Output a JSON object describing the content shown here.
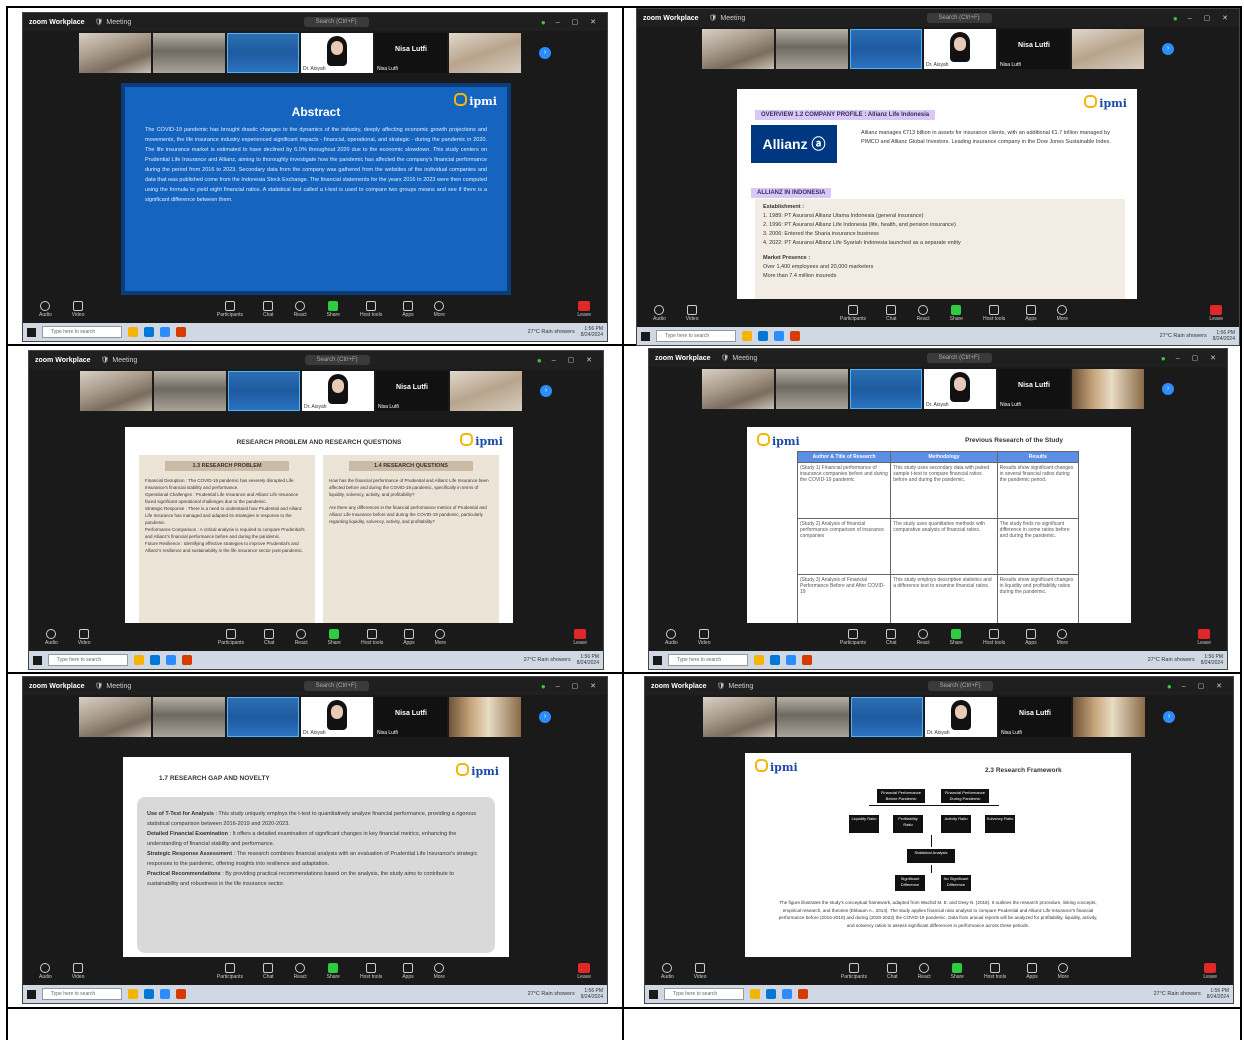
{
  "zoom": {
    "brand": "zoom\nWorkplace",
    "meeting_label": "Meeting",
    "search_placeholder": "Search (Ctrl+F)",
    "win_controls": "– ▢ ✕",
    "more_participants_arrow": "›"
  },
  "participants": {
    "dr_label": "Dr. Aisyah",
    "nisa_name": "Nisa Lutfi",
    "nisa_sub": "Nisa Lutfi"
  },
  "controls": {
    "audio": "Audio",
    "video": "Video",
    "participants": "Participants",
    "chat": "Chat",
    "react": "React",
    "share": "Share",
    "host_tools": "Host tools",
    "apps": "Apps",
    "more": "More",
    "leave": "Leave"
  },
  "taskbar": {
    "search_placeholder": "Type here to search",
    "weather": "27°C Rain showers",
    "clock_time": "1:56 PM",
    "clock_date": "8/24/2024"
  },
  "slides": {
    "logo_text": "ipmi",
    "abstract": {
      "title": "Abstract",
      "text": "The COVID-19 pandemic has brought drastic changes to the dynamics of the industry, deeply affecting economic growth projections and movements, the life insurance industry experienced significant impacts - financial, operational, and strategic - during the pandemic in 2020. The life insurance market is estimated to have declined by 6.0% throughout 2020 due to the economic slowdown. This study centers on Prudential Life Insurance and Allianz, aiming to thoroughly investigate how the pandemic has affected the company's financial performance during the period from 2016 to 2023. Secondary data from the company was gathered from the websites of the individual companies and data that was published come from the Indonesia Stock Exchange. The financial statements for the years 2016 to 2023 were then computed using the formula to yield eight financial ratios. A statistical test called a t-test is used to compare two groups means and see if there is a significant difference between them."
    },
    "allianz": {
      "section": "OVERVIEW  1.2 COMPANY PROFILE : Allianz Life Indonesia",
      "logo": "Allianz ⓐ",
      "desc": "Allianz manages €713 billion in assets for insurance clients, with an additional €1.7 trillion managed by PIMCO and Allianz Global Investors. Leading insurance company in the Dow Jones Sustainable Index.",
      "sub": "ALLIANZ IN INDONESIA",
      "est_title": "Establishment :",
      "est_items": [
        "1. 1989: PT Asuransi Allianz Utama Indonesia (general insurance)",
        "2. 1996: PT Asuransi Allianz Life Indonesia (life, health, and pension insurance)",
        "3. 2006: Entered the Sharia insurance business",
        "4. 2022: PT Asuransi Allianz Life Syariah Indonesia launched as a separate entity"
      ],
      "market_title": "Market Presence :",
      "market_items": [
        "Over 1,400 employees and 20,000 marketers",
        "More than 7.4 million insureds"
      ]
    },
    "research": {
      "title": "RESEARCH PROBLEM AND RESEARCH QUESTIONS",
      "left_header": "1.3 RESEARCH PROBLEM",
      "left_items": [
        "Financial Disruption : The COVID-19 pandemic has severely disrupted Life Insurance's financial stability and performance.",
        "Operational Challenges : Prudential Life Insurance and Allianz Life Insurance faced significant operational challenges due to the pandemic.",
        "Strategic Response : There is a need to understand how Prudential and Allianz Life Insurance has managed and adapted its strategies in response to the pandemic.",
        "Performance Comparison : A critical analysis is required to compare Prudential's and Allianz's financial performance before and during the pandemic.",
        "Future Resilience : Identifying effective strategies to improve Prudential's and Allianz's resilience and sustainability in the life insurance sector post-pandemic."
      ],
      "right_header": "1.4 RESEARCH QUESTIONS",
      "right_items": [
        "How has the financial performance of Prudential and Allianz Life Insurance been affected before and during the COVID-19 pandemic, specifically in terms of liquidity, solvency, activity, and profitability?",
        "Are there any differences in the financial performance metrics of Prudential and Allianz Life Insurance before and during the COVID-19 pandemic, particularly regarding liquidity, solvency, activity, and profitability?"
      ]
    },
    "previous": {
      "title": "Previous Research of the Study",
      "headers": [
        "Author & Title of Research",
        "Methodology",
        "Results"
      ],
      "rows": [
        [
          "(Study 1) Financial performance of insurance companies before and during the COVID-19 pandemic",
          "This study uses secondary data with paired sample t-test to compare financial ratios before and during the pandemic.",
          "Results show significant changes in several financial ratios during the pandemic period."
        ],
        [
          "(Study 2) Analysis of financial performance comparison of insurance companies",
          "The study uses quantitative methods with comparative analysis of financial ratios.",
          "The study finds no significant difference in some ratios before and during the pandemic."
        ],
        [
          "(Study 3) Analysis of Financial Performance Before and After COVID-19",
          "This study employs descriptive statistics and a difference test to examine financial ratios.",
          "Results show significant changes in liquidity and profitability ratios during the pandemic."
        ]
      ]
    },
    "gap": {
      "title": "1.7 RESEARCH GAP AND NOVELTY",
      "items": [
        {
          "b": "Use of T-Test for Analysis",
          "t": ": This study uniquely employs the t-test to quantitatively analyze financial performance, providing a rigorous statistical comparison between 2016-2019 and 2020-2023."
        },
        {
          "b": "Detailed Financial Examination",
          "t": ": It offers a detailed examination of significant changes in key financial metrics, enhancing the understanding of financial stability and performance."
        },
        {
          "b": "Strategic Response Assessment",
          "t": ": The research combines financial analysis with an evaluation of Prudential Life Insurance's strategic responses to the pandemic, offering insights into resilience and adaptation."
        },
        {
          "b": "Practical Recommendations",
          "t": ": By providing practical recommendations based on the analysis, the study aims to contribute to sustainability and robustness in the life insurance sector."
        }
      ]
    },
    "framework": {
      "title": "2.3 Research Framework",
      "top_left": "Financial Performance Before Pandemic",
      "top_right": "Financial Performance During Pandemic",
      "ratios": [
        "Liquidity Ratio",
        "Profitability Ratio",
        "Activity Ratio",
        "Solvency Ratio"
      ],
      "middle": "Statistical Analysis",
      "bottom_left": "Significant Difference",
      "bottom_right": "No Significant Difference",
      "caption": "The figure illustrates the study's conceptual framework, adapted from Wachid M. E. and Desy N. (2018). It outlines the research procedure, linking concepts, empirical research, and theories (Ekbaum A., 2014). The study applies financial ratio analysis to compare Prudential and Allianz Life Insurance's financial performance before (2016-2019) and during (2020-2023) the COVID-19 pandemic. Data from annual reports will be analyzed for profitability, liquidity, activity, and solvency ratios to assess significant differences in performance across these periods."
    }
  },
  "colors": {
    "abstract_bg": "#1565c0",
    "share_green": "#2ecc40",
    "leave_red": "#e02828",
    "table_header": "#5b8ee6"
  }
}
